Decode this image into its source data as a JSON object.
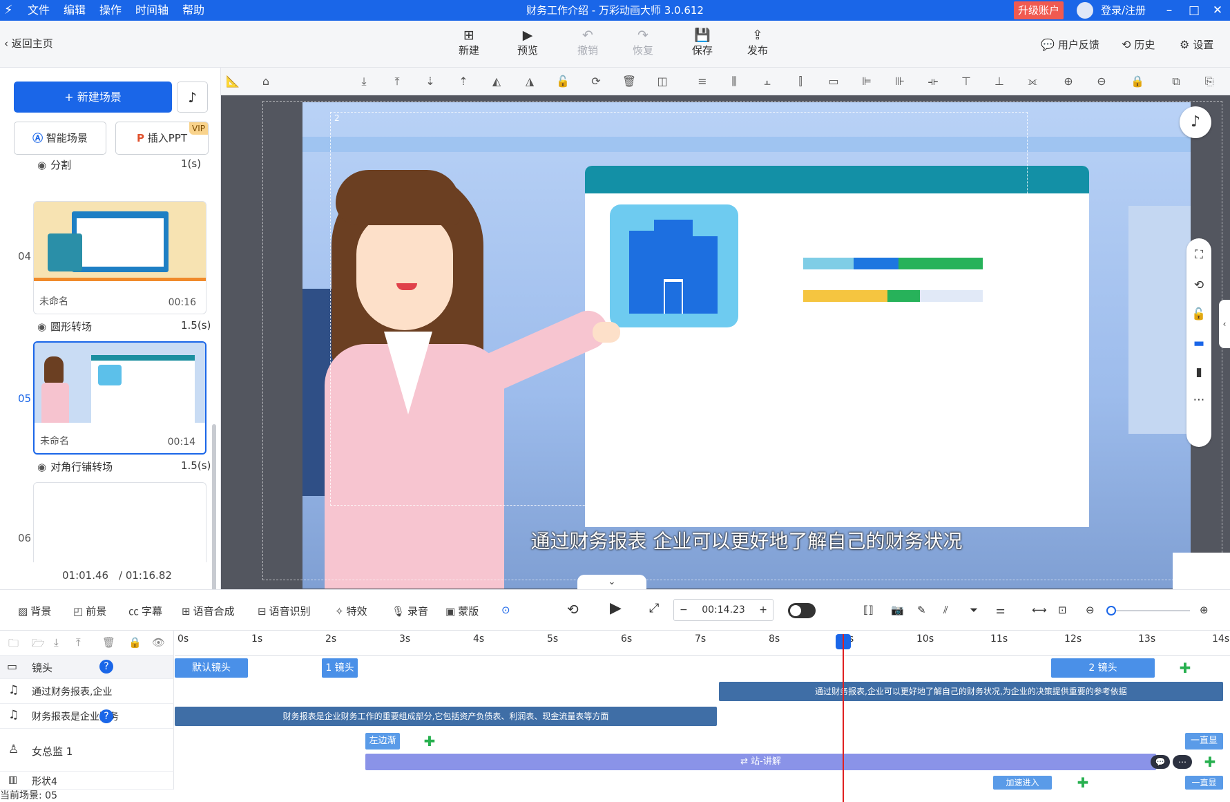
{
  "titlebar": {
    "menu": [
      "文件",
      "编辑",
      "操作",
      "时间轴",
      "帮助"
    ],
    "title": "财务工作介绍 - 万彩动画大师 3.0.612",
    "upgrade": "升级账户",
    "login": "登录/注册"
  },
  "toolbar": {
    "back": "返回主页",
    "new": "新建",
    "preview": "预览",
    "undo": "撤销",
    "redo": "恢复",
    "save": "保存",
    "publish": "发布",
    "feedback": "用户反馈",
    "history": "历史",
    "settings": "设置"
  },
  "leftpanel": {
    "new_scene": "+ 新建场景",
    "smart_scene": "智能场景",
    "insert_ppt": "插入PPT",
    "vip": "VIP",
    "transitions": [
      {
        "label": "分割",
        "dur": "1(s)"
      },
      {
        "label": "圆形转场",
        "dur": "1.5(s)"
      },
      {
        "label": "对角行铺转场",
        "dur": "1.5(s)"
      }
    ],
    "scenes": [
      {
        "num": "04",
        "name": "未命名",
        "dur": "00:16"
      },
      {
        "num": "05",
        "name": "未命名",
        "dur": "00:14"
      },
      {
        "num": "06"
      }
    ],
    "time_current": "01:01.46",
    "time_total": "/ 01:16.82"
  },
  "canvas": {
    "subtitle": "通过财务报表 企业可以更好地了解自己的财务状况",
    "label_2": "2",
    "label_1": "默认镜头1"
  },
  "controls": {
    "tools": [
      "背景",
      "前景",
      "字幕",
      "语音合成",
      "语音识别",
      "特效",
      "录音",
      "蒙版"
    ],
    "time": "00:14.23"
  },
  "timeline": {
    "ruler": [
      "0s",
      "1s",
      "2s",
      "3s",
      "4s",
      "5s",
      "6s",
      "7s",
      "8s",
      "9s",
      "10s",
      "11s",
      "12s",
      "13s",
      "14s"
    ],
    "tracks": [
      {
        "name": "镜头"
      },
      {
        "name": "通过财务报表,企业"
      },
      {
        "name": "财务报表是企业财务"
      },
      {
        "name": "女总监 1"
      },
      {
        "name": "形状4"
      }
    ],
    "clips": {
      "cam_default": "默认镜头",
      "cam_1": "1 镜头",
      "cam_2": "2 镜头",
      "audio1_text": "通过财务报表,企业可以更好地了解自己的财务状况,为企业的决策提供重要的参考依据",
      "audio2_text": "财务报表是企业财务工作的重要组成部分,它包括资产负债表、利润表、现金流量表等方面",
      "left_enter": "左边渐",
      "stand_talk": "站-讲解",
      "always_show": "一直显",
      "accel_enter": "加速进入",
      "always_show2": "一直显"
    },
    "status": "当前场景: 05"
  }
}
